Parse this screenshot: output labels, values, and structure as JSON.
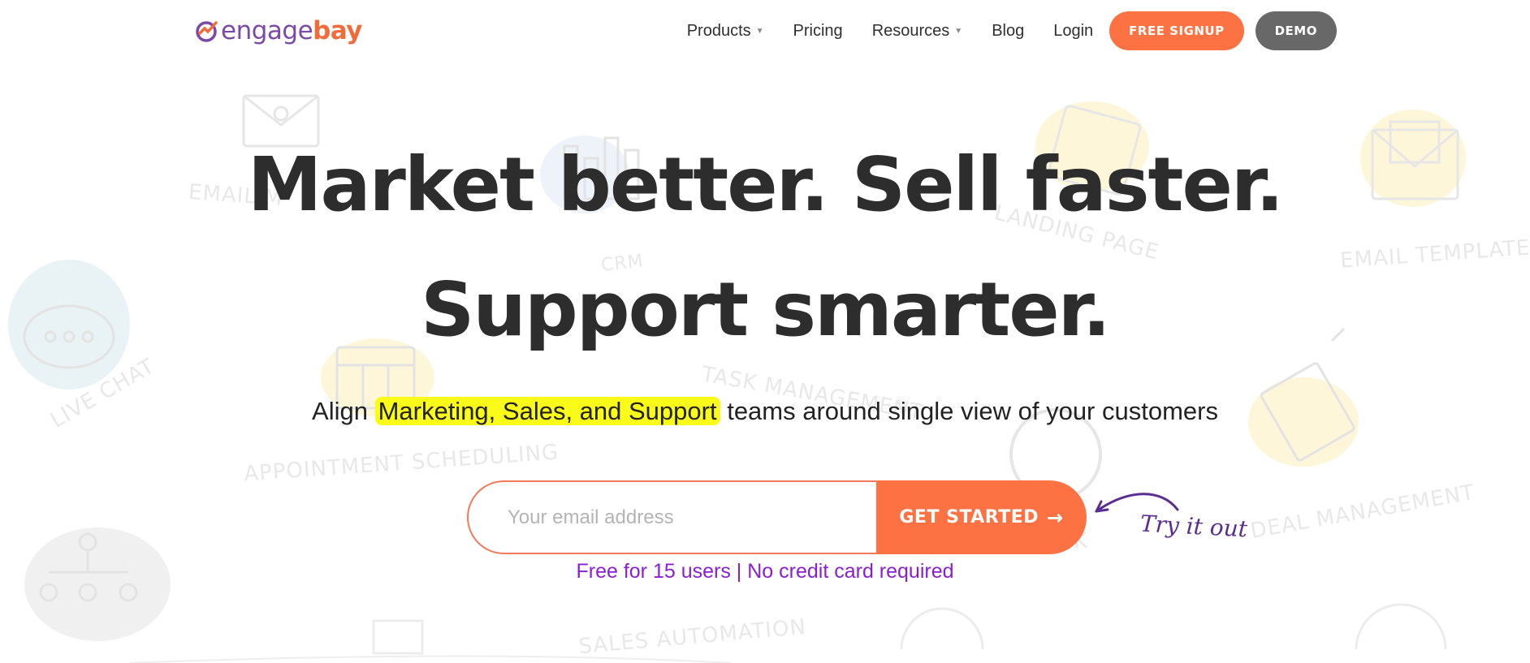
{
  "colors": {
    "accent": "#fc7242",
    "logo_purple": "#7b4aa8",
    "demo_gray": "#686868",
    "highlight": "#fbfb19",
    "note_purple": "#8b1fd0"
  },
  "logo": {
    "part1": "engage",
    "part2": "bay",
    "icon": "engagebay-logo-icon"
  },
  "nav": {
    "products": "Products",
    "pricing": "Pricing",
    "resources": "Resources",
    "blog": "Blog",
    "login": "Login",
    "signup": "FREE SIGNUP",
    "demo": "DEMO"
  },
  "hero": {
    "line1": "Market better. Sell faster.",
    "line2": "Support smarter.",
    "sub_before": "Align ",
    "sub_highlight": "Marketing, Sales, and Support",
    "sub_after": " teams around single view of your customers"
  },
  "form": {
    "email_placeholder": "Your email address",
    "cta": "GET STARTED",
    "cta_arrow": "→",
    "try_label": "Try it out",
    "note": "Free for 15 users | No credit card required"
  },
  "background_labels": {
    "email": "EMAIL M",
    "crm": "CRM",
    "landing": "LANDING PAGE",
    "templates": "EMAIL TEMPLATES",
    "live_chat": "LIVE CHAT",
    "task": "TASK MANAGEMENT",
    "appointment": "APPOINTMENT SCHEDULING",
    "deal": "DEAL MANAGEMENT",
    "sales_auto": "SALES AUTOMATION",
    "helpdesk": "K"
  }
}
